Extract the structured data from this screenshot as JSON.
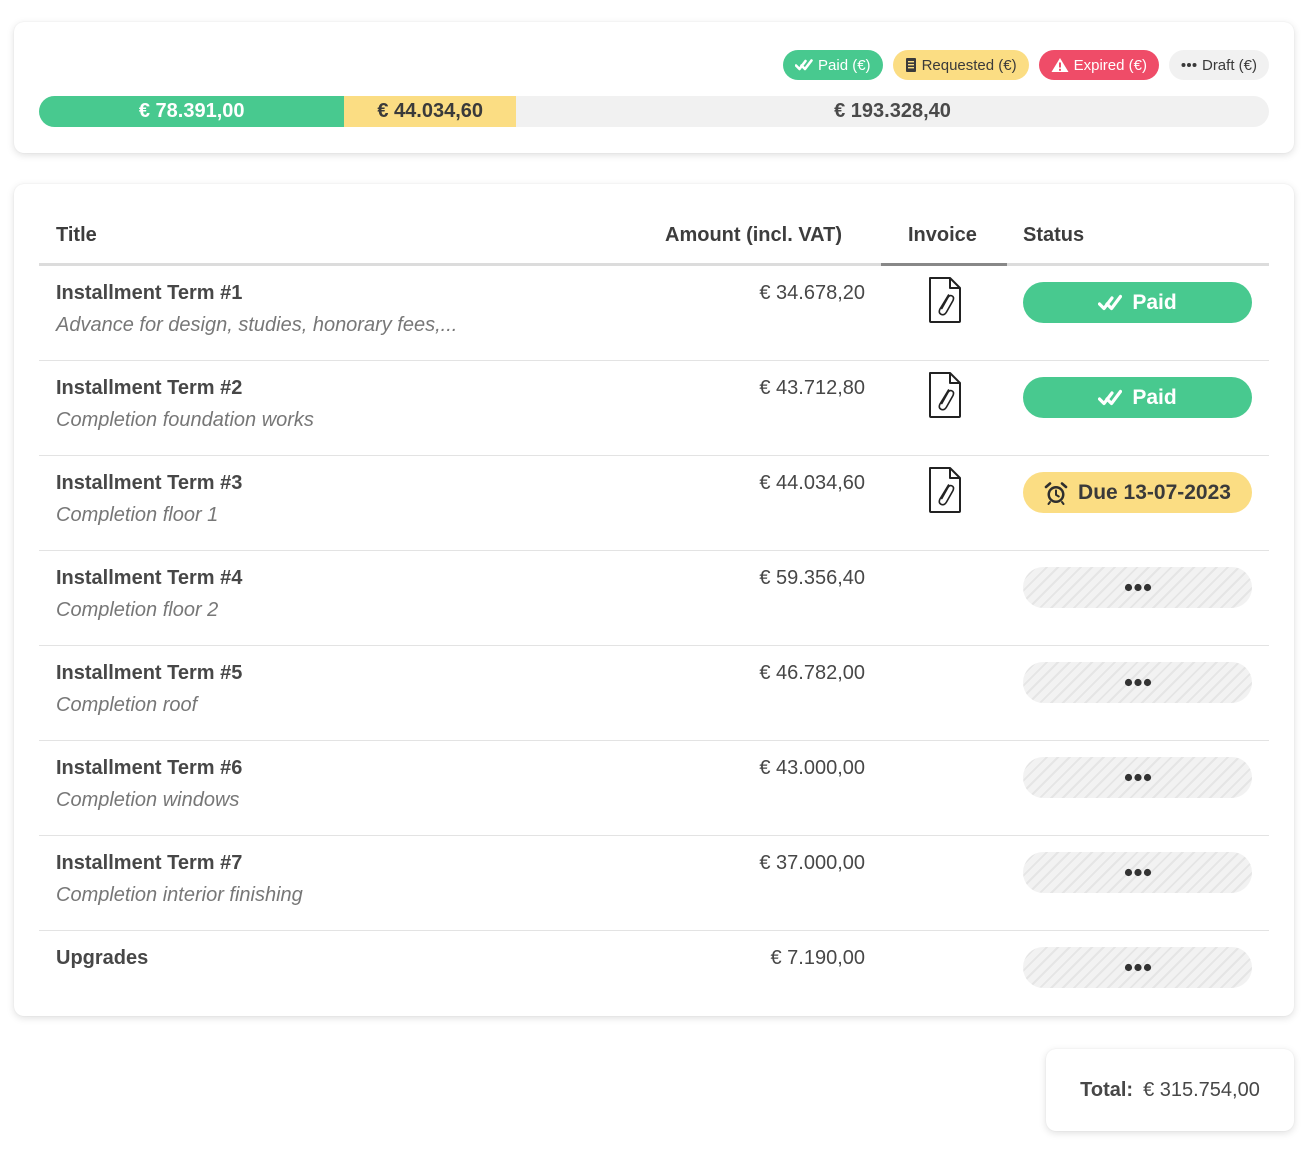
{
  "summary": {
    "legend": {
      "paid": "Paid (€)",
      "requested": "Requested (€)",
      "expired": "Expired (€)",
      "draft": "Draft (€)"
    },
    "bar": {
      "paid_label": "€ 78.391,00",
      "requested_label": "€ 44.034,60",
      "remaining_label": "€ 193.328,40",
      "paid_fraction": 0.2483,
      "requested_fraction": 0.1395,
      "remaining_fraction": 0.6122
    },
    "colors": {
      "paid": "#48c98f",
      "requested": "#fbdd83",
      "expired": "#ef4c68",
      "draft": "#f1f1f1"
    }
  },
  "table": {
    "headers": {
      "title": "Title",
      "amount": "Amount (incl. VAT)",
      "invoice": "Invoice",
      "status": "Status"
    },
    "rows": [
      {
        "title": "Installment Term #1",
        "desc": "Advance for design, studies, honorary fees,...",
        "amount": "€ 34.678,20",
        "invoice": "attachment-file-icon",
        "status_type": "paid",
        "status_label": "Paid"
      },
      {
        "title": "Installment Term #2",
        "desc": "Completion foundation works",
        "amount": "€ 43.712,80",
        "invoice": "attachment-file-icon",
        "status_type": "paid",
        "status_label": "Paid"
      },
      {
        "title": "Installment Term #3",
        "desc": "Completion floor 1",
        "amount": "€ 44.034,60",
        "invoice": "attachment-file-icon",
        "status_type": "due",
        "status_label": "Due 13-07-2023"
      },
      {
        "title": "Installment Term #4",
        "desc": "Completion floor 2",
        "amount": "€ 59.356,40",
        "invoice": "",
        "status_type": "draft",
        "status_label": ""
      },
      {
        "title": "Installment Term #5",
        "desc": "Completion roof",
        "amount": "€ 46.782,00",
        "invoice": "",
        "status_type": "draft",
        "status_label": ""
      },
      {
        "title": "Installment Term #6",
        "desc": "Completion windows",
        "amount": "€ 43.000,00",
        "invoice": "",
        "status_type": "draft",
        "status_label": ""
      },
      {
        "title": "Installment Term #7",
        "desc": "Completion interior finishing",
        "amount": "€ 37.000,00",
        "invoice": "",
        "status_type": "draft",
        "status_label": ""
      },
      {
        "title": "Upgrades",
        "desc": "",
        "amount": "€ 7.190,00",
        "invoice": "",
        "status_type": "draft",
        "status_label": ""
      }
    ]
  },
  "total": {
    "label": "Total:",
    "value": "€ 315.754,00"
  }
}
